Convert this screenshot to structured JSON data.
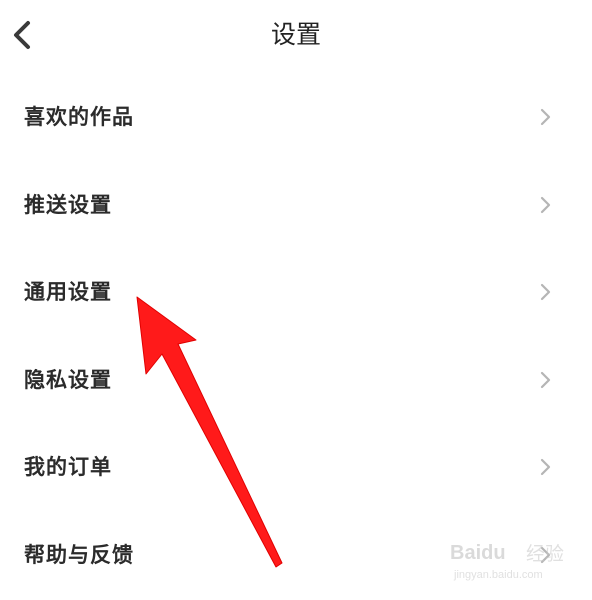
{
  "header": {
    "title": "设置",
    "back_icon": "chevron-left-icon"
  },
  "menu": {
    "items": [
      {
        "label": "喜欢的作品"
      },
      {
        "label": "推送设置"
      },
      {
        "label": "通用设置"
      },
      {
        "label": "隐私设置"
      },
      {
        "label": "我的订单"
      },
      {
        "label": "帮助与反馈"
      }
    ],
    "chevron_icon": "chevron-right-icon"
  },
  "annotation": {
    "arrow_color": "#ff1a1a",
    "points_to": "通用设置"
  },
  "watermark": {
    "brand": "Baidu",
    "jingyan": "经验",
    "url": "jingyan.baidu.com"
  }
}
